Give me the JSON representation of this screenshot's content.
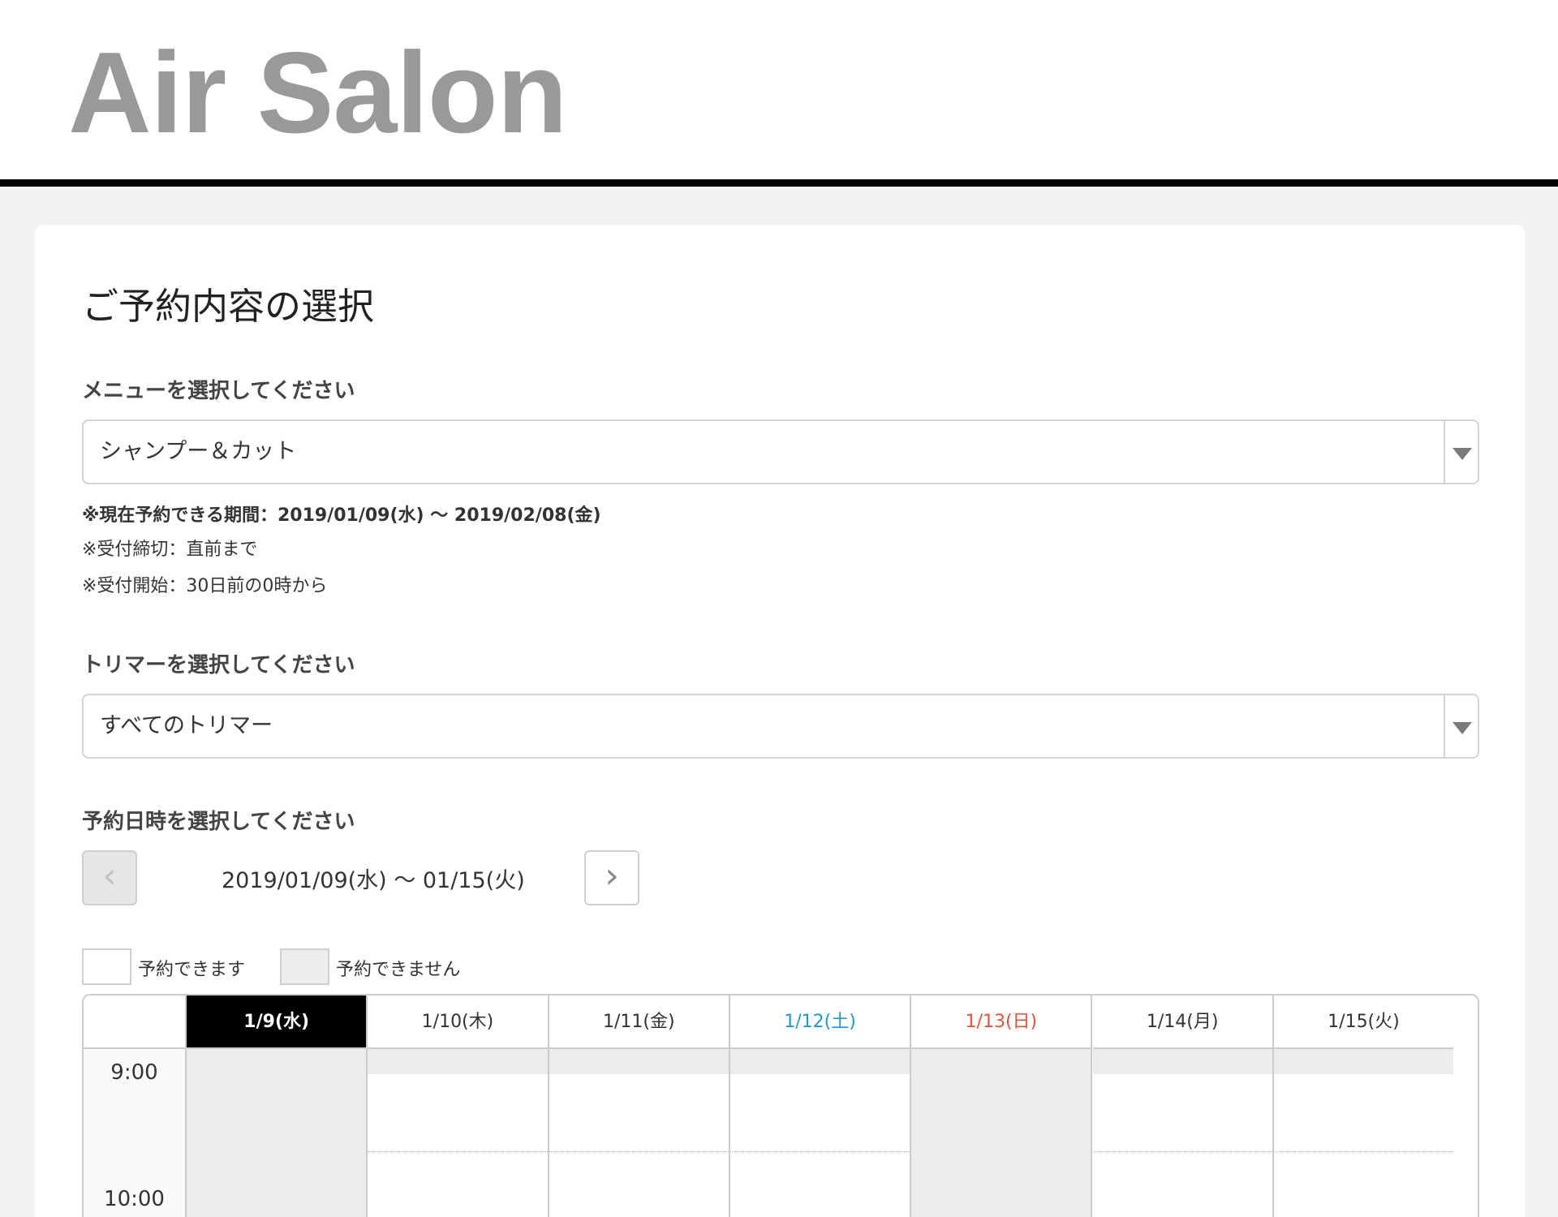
{
  "header": {
    "logo": "Air Salon"
  },
  "page_title": "ご予約内容の選択",
  "menu": {
    "label": "メニューを選択してください",
    "value": "シャンプー＆カット",
    "notes": [
      "※現在予約できる期間：2019/01/09(水) 〜 2019/02/08(金)",
      "※受付締切：直前まで",
      "※受付開始：30日前の0時から"
    ]
  },
  "trimmer": {
    "label": "トリマーを選択してください",
    "value": "すべてのトリマー"
  },
  "datetime": {
    "label": "予約日時を選択してください",
    "prev": "‹",
    "next": "›",
    "range": "2019/01/09(水) 〜 01/15(火)"
  },
  "legend": {
    "available": "予約できます",
    "unavailable": "予約できません"
  },
  "calendar": {
    "days": [
      {
        "label": "1/9(水)",
        "type": "today",
        "closed": true
      },
      {
        "label": "1/10(木)",
        "type": "weekday",
        "closed": false
      },
      {
        "label": "1/11(金)",
        "type": "weekday",
        "closed": false
      },
      {
        "label": "1/12(土)",
        "type": "saturday",
        "closed": false
      },
      {
        "label": "1/13(日)",
        "type": "sunday",
        "closed": true
      },
      {
        "label": "1/14(月)",
        "type": "weekday",
        "closed": false
      },
      {
        "label": "1/15(火)",
        "type": "weekday",
        "closed": false
      }
    ],
    "times": [
      "9:00",
      "10:00"
    ]
  },
  "colors": {
    "today_bg": "#000000",
    "saturday": "#1a9ad6",
    "sunday": "#e8503a",
    "unavailable": "#ececec"
  }
}
